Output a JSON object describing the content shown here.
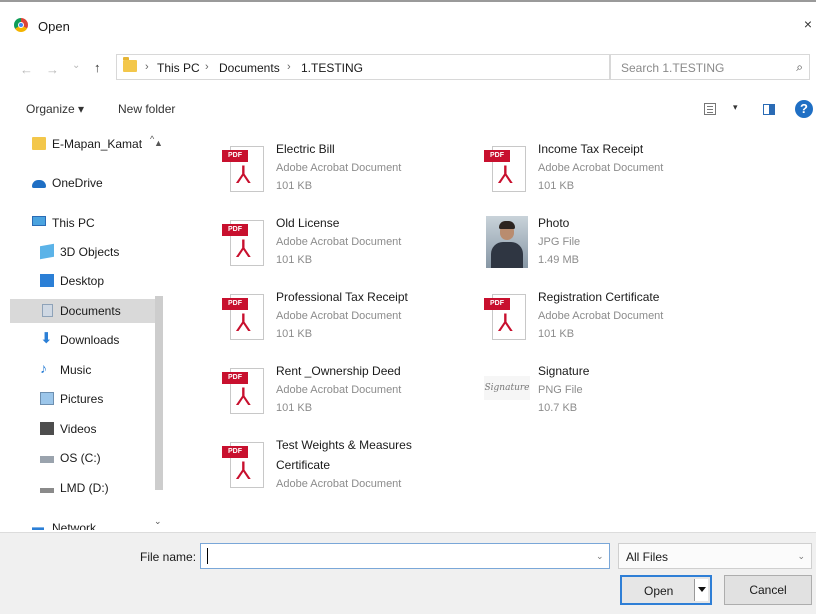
{
  "window": {
    "title": "Open",
    "close_glyph": "×"
  },
  "nav": {
    "back_glyph": "←",
    "forward_glyph": "→",
    "recent_glyph": "⌄",
    "up_glyph": "↑",
    "breadcrumb": [
      "This PC",
      "Documents",
      "1.TESTING"
    ],
    "search_placeholder": "Search 1.TESTING"
  },
  "toolbar": {
    "organize": "Organize ▾",
    "new_folder": "New folder",
    "help": "?"
  },
  "sidebar": {
    "items": [
      {
        "label": "E-Mapan_Kamat",
        "icon": "folder-icon"
      },
      {
        "label": "OneDrive",
        "icon": "onedrive-icon"
      },
      {
        "label": "This PC",
        "icon": "pc-icon"
      },
      {
        "label": "3D Objects",
        "icon": "3d-objects-icon"
      },
      {
        "label": "Desktop",
        "icon": "desktop-icon"
      },
      {
        "label": "Documents",
        "icon": "documents-icon"
      },
      {
        "label": "Downloads",
        "icon": "downloads-icon"
      },
      {
        "label": "Music",
        "icon": "music-icon"
      },
      {
        "label": "Pictures",
        "icon": "pictures-icon"
      },
      {
        "label": "Videos",
        "icon": "videos-icon"
      },
      {
        "label": "OS (C:)",
        "icon": "drive-icon"
      },
      {
        "label": "LMD (D:)",
        "icon": "drive-icon"
      },
      {
        "label": "Network",
        "icon": "network-icon"
      }
    ]
  },
  "files": [
    {
      "name": "Electric Bill",
      "type": "Adobe Acrobat Document",
      "size": "101 KB",
      "icon": "pdf-icon"
    },
    {
      "name": "Income Tax Receipt",
      "type": "Adobe Acrobat Document",
      "size": "101 KB",
      "icon": "pdf-icon"
    },
    {
      "name": "Old License",
      "type": "Adobe Acrobat Document",
      "size": "101 KB",
      "icon": "pdf-icon"
    },
    {
      "name": "Photo",
      "type": "JPG File",
      "size": "1.49 MB",
      "icon": "photo-thumbnail"
    },
    {
      "name": "Professional Tax Receipt",
      "type": "Adobe Acrobat Document",
      "size": "101 KB",
      "icon": "pdf-icon"
    },
    {
      "name": "Registration Certificate",
      "type": "Adobe Acrobat Document",
      "size": "101 KB",
      "icon": "pdf-icon"
    },
    {
      "name": "Rent _Ownership Deed",
      "type": "Adobe Acrobat Document",
      "size": "101 KB",
      "icon": "pdf-icon"
    },
    {
      "name": "Signature",
      "type": "PNG File",
      "size": "10.7 KB",
      "icon": "signature-thumbnail"
    },
    {
      "name": "Test Weights & Measures",
      "name2": "Certificate",
      "type": "Adobe Acrobat Document",
      "icon": "pdf-icon"
    }
  ],
  "footer": {
    "file_name_label": "File name:",
    "file_name_value": "",
    "filter_value": "All Files",
    "open_label": "Open",
    "cancel_label": "Cancel"
  }
}
